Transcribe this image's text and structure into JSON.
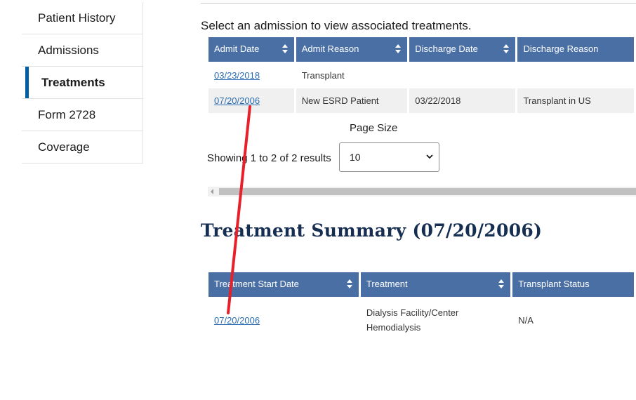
{
  "sidebar": {
    "items": [
      {
        "label": "Patient History"
      },
      {
        "label": "Admissions"
      },
      {
        "label": "Treatments"
      },
      {
        "label": "Form 2728"
      },
      {
        "label": "Coverage"
      }
    ]
  },
  "admissions": {
    "instruction": "Select an admission to view associated treatments.",
    "columns": [
      "Admit Date",
      "Admit Reason",
      "Discharge Date",
      "Discharge Reason"
    ],
    "rows": [
      {
        "admit_date": "03/23/2018",
        "admit_reason": "Transplant",
        "discharge_date": "",
        "discharge_reason": ""
      },
      {
        "admit_date": "07/20/2006",
        "admit_reason": "New ESRD Patient",
        "discharge_date": "03/22/2018",
        "discharge_reason": "Transplant in US"
      }
    ],
    "page_size_label": "Page Size",
    "showing_text": "Showing 1 to 2 of 2 results",
    "page_size_value": "10"
  },
  "treatment_summary": {
    "title": "Treatment Summary (07/20/2006)",
    "columns": [
      "Treatment Start Date",
      "Treatment",
      "Transplant Status"
    ],
    "rows": [
      {
        "start_date": "07/20/2006",
        "treatment_line1": "Dialysis Facility/Center",
        "treatment_line2": "Hemodialysis",
        "transplant_status": "N/A"
      }
    ]
  },
  "colors": {
    "header_bg": "#4a6fa5",
    "active_indicator": "#005ea2",
    "link": "#2b6cb0",
    "annotation": "#e8202a"
  },
  "icons": [
    "sort-icon",
    "chevron-down-icon",
    "scroll-left-arrow-icon"
  ]
}
